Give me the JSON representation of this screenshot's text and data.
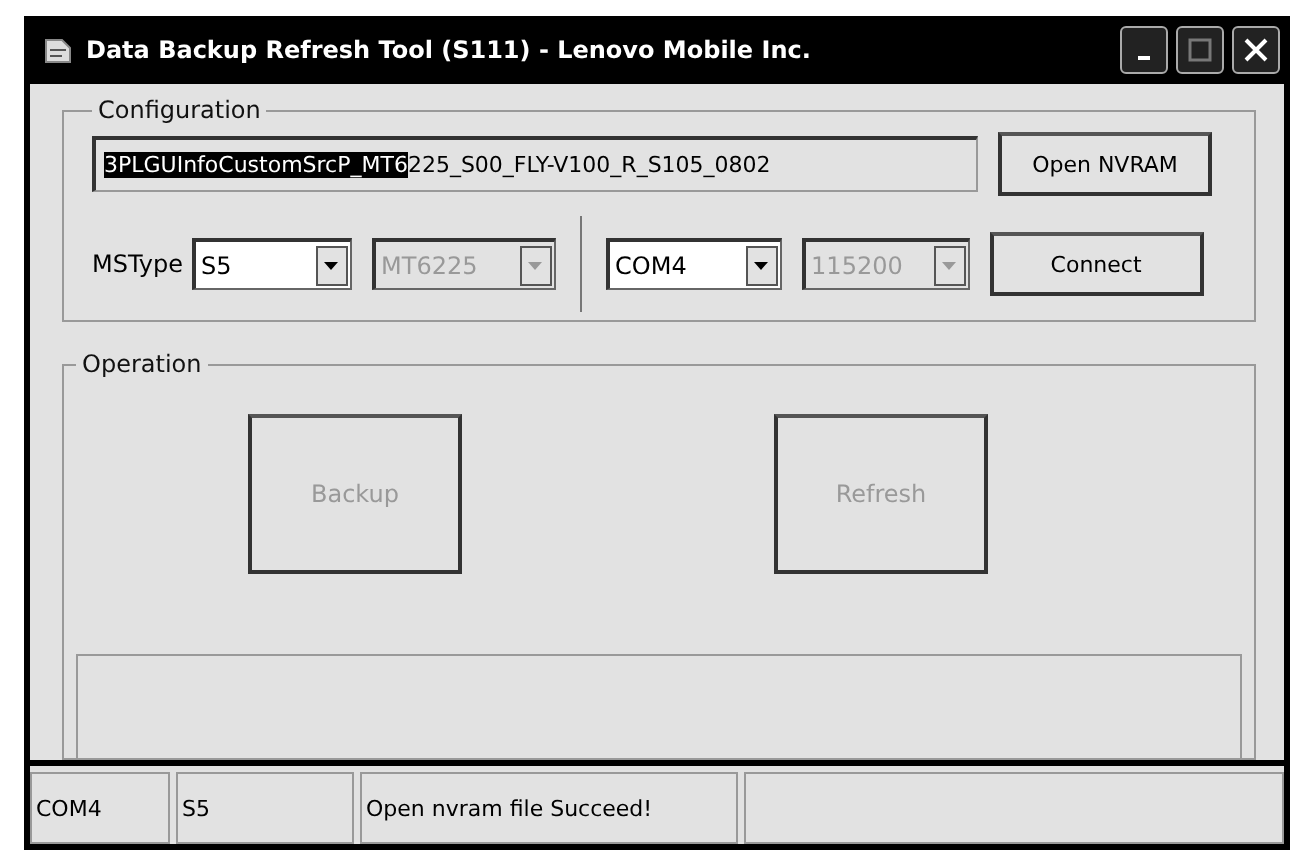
{
  "window": {
    "title": "Data Backup Refresh Tool (S111) - Lenovo Mobile Inc."
  },
  "configuration": {
    "label": "Configuration",
    "path_field": {
      "selected_part": "3PLGUInfoCustomSrcP_MT6",
      "rest": "225_S00_FLY-V100_R_S105_0802"
    },
    "open_button": {
      "label": "Open NVRAM",
      "disabled": false
    },
    "mstype_label": "MSType",
    "dropdowns": [
      {
        "value": "S5",
        "disabled": false
      },
      {
        "value": "MT6225",
        "disabled": true
      },
      {
        "value": "COM4",
        "disabled": false
      },
      {
        "value": "115200",
        "disabled": true
      }
    ],
    "connect_button": {
      "label": "Connect",
      "disabled": false
    }
  },
  "operation": {
    "label": "Operation",
    "buttons": [
      {
        "label": "Backup",
        "disabled": true
      },
      {
        "label": "Refresh",
        "disabled": true
      }
    ]
  },
  "status_bar": [
    "COM4",
    "S5",
    "Open nvram file Succeed!"
  ]
}
